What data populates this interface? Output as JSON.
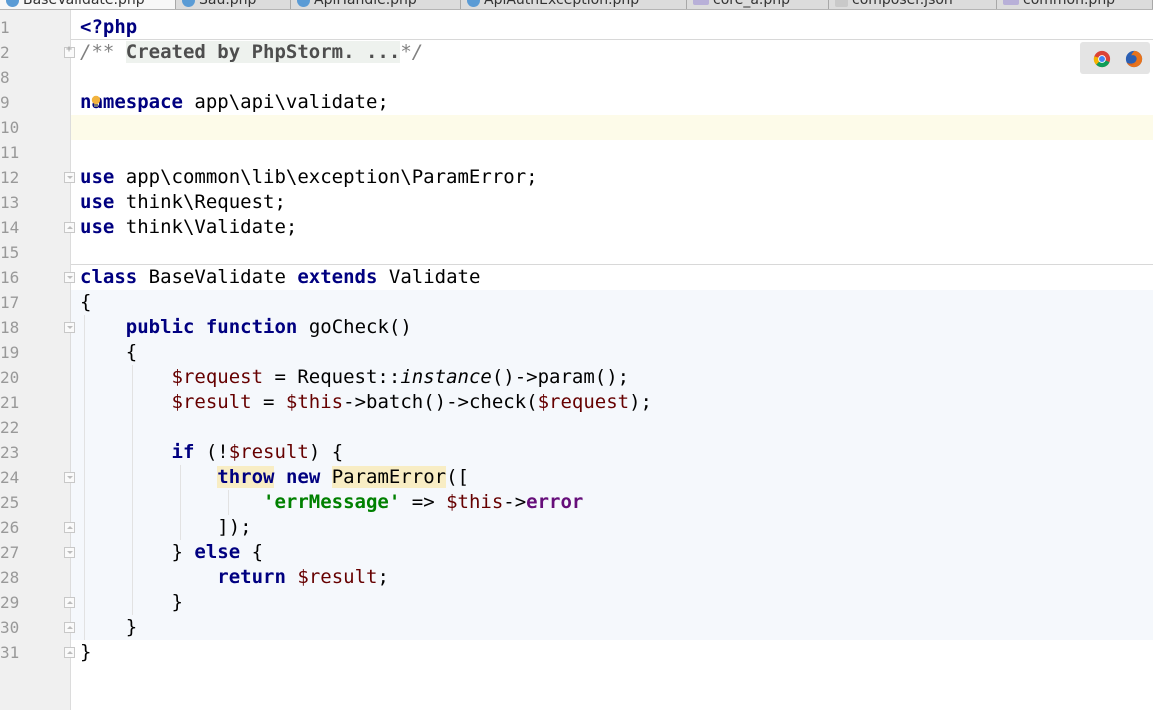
{
  "tabs": [
    {
      "label": "BaseValidate.php",
      "icon": "php-class-icon",
      "active": true
    },
    {
      "label": "Sau.php",
      "icon": "php-class-icon"
    },
    {
      "label": "ApiHandle.php",
      "icon": "php-class-icon"
    },
    {
      "label": "ApiAuthException.php",
      "icon": "php-class-icon"
    },
    {
      "label": "core_a.php",
      "icon": "php-file-icon"
    },
    {
      "label": "composer.json",
      "icon": "json-file-icon"
    },
    {
      "label": "common.php",
      "icon": "php-file-icon"
    }
  ],
  "browser_icons": [
    "chrome-icon",
    "firefox-icon"
  ],
  "gutter": {
    "line_numbers": [
      "1",
      "2",
      "8",
      "9",
      "10",
      "11",
      "12",
      "13",
      "14",
      "15",
      "16",
      "17",
      "18",
      "19",
      "20",
      "21",
      "22",
      "23",
      "24",
      "25",
      "26",
      "27",
      "28",
      "29",
      "30",
      "31"
    ]
  },
  "code": {
    "l1": "<?php",
    "l2_open": "/** ",
    "l2_folded": "Created by PhpStorm. ...",
    "l2_close": "*/",
    "l9_kw": "namespace",
    "l9_rest": " app\\api\\validate;",
    "use_kw": "use",
    "l12_rest": " app\\common\\lib\\exception\\ParamError;",
    "l13_rest": " think\\Request;",
    "l14_rest": " think\\Validate;",
    "l16_class": "class",
    "l16_name": " BaseValidate ",
    "l16_extends": "extends",
    "l16_parent": " Validate",
    "open_brace": "{",
    "close_brace": "}",
    "l18_public": "public",
    "l18_function": "function",
    "l18_name": " goCheck()",
    "l20_var": "$request",
    "l20_mid": " = Request::",
    "l20_instance": "instance",
    "l20_end": "()->param();",
    "l21_var": "$result",
    "l21_eq": " = ",
    "this_var": "$this",
    "l21_mid": "->batch()->check(",
    "l21_end": ");",
    "l23_if": "if",
    "l23_open": " (!",
    "l23_close": ") {",
    "l24_throw": "throw",
    "l24_new": "new",
    "l24_class": "ParamError",
    "l24_end": "([",
    "l25_str": "'errMessage'",
    "l25_arrow": " => ",
    "l25_arrow2": "->",
    "l25_prop": "error",
    "l26": "]);",
    "l27_close": "} ",
    "l27_else": "else",
    "l27_open": " {",
    "l28_return": "return",
    "l28_end": ";"
  }
}
